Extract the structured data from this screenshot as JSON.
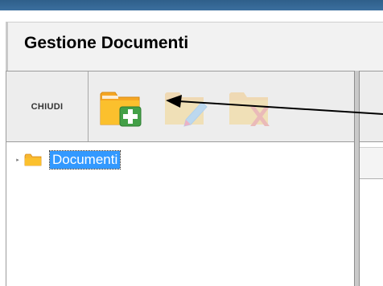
{
  "window": {
    "title": "Gestione Documenti"
  },
  "toolbar": {
    "close_label": "CHIUDI",
    "buttons": [
      {
        "icon": "folder-add-icon",
        "state": "enabled"
      },
      {
        "icon": "folder-edit-icon",
        "state": "disabled"
      },
      {
        "icon": "folder-delete-icon",
        "state": "disabled"
      }
    ]
  },
  "tree": {
    "root": {
      "label": "Documenti",
      "selected": true,
      "icon": "folder-icon"
    }
  },
  "colors": {
    "selection": "#3399ff",
    "folder": "#f7b731",
    "add_plus": "#4caf50",
    "delete_x": "#e53935",
    "top_strip": "#2f5f8a"
  }
}
